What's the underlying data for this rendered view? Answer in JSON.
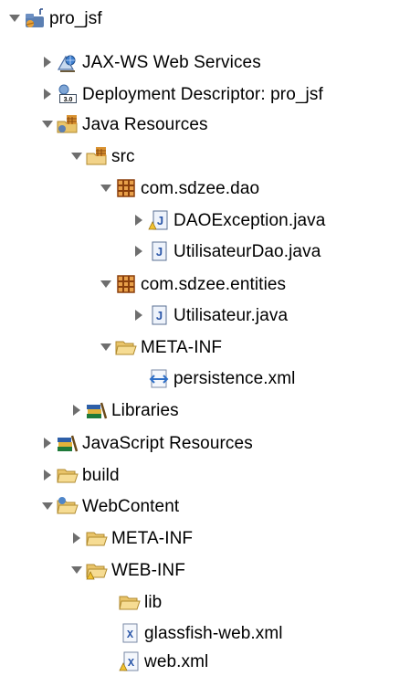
{
  "tree": {
    "nodes": [
      {
        "label": "pro_jsf",
        "icon": "project-icon",
        "expanded": true
      },
      {
        "label": "JAX-WS Web Services",
        "icon": "web-services-icon",
        "expanded": false
      },
      {
        "label": "Deployment Descriptor: pro_jsf",
        "icon": "deployment-descriptor-icon",
        "expanded": false
      },
      {
        "label": "Java Resources",
        "icon": "java-resources-icon",
        "expanded": true
      },
      {
        "label": "src",
        "icon": "source-folder-icon",
        "expanded": true
      },
      {
        "label": "com.sdzee.dao",
        "icon": "package-icon",
        "expanded": true
      },
      {
        "label": "DAOException.java",
        "icon": "java-file-warning-icon",
        "expanded": false
      },
      {
        "label": "UtilisateurDao.java",
        "icon": "java-file-icon",
        "expanded": false
      },
      {
        "label": "com.sdzee.entities",
        "icon": "package-icon",
        "expanded": true
      },
      {
        "label": "Utilisateur.java",
        "icon": "java-file-icon",
        "expanded": false
      },
      {
        "label": "META-INF",
        "icon": "folder-icon",
        "expanded": true
      },
      {
        "label": "persistence.xml",
        "icon": "persistence-xml-icon",
        "expanded": null
      },
      {
        "label": "Libraries",
        "icon": "libraries-icon",
        "expanded": false
      },
      {
        "label": "JavaScript Resources",
        "icon": "libraries-icon",
        "expanded": false
      },
      {
        "label": "build",
        "icon": "folder-icon",
        "expanded": false
      },
      {
        "label": "WebContent",
        "icon": "folder-icon",
        "expanded": true
      },
      {
        "label": "META-INF",
        "icon": "folder-icon",
        "expanded": false
      },
      {
        "label": "WEB-INF",
        "icon": "folder-icon",
        "expanded": true
      },
      {
        "label": "lib",
        "icon": "folder-icon",
        "expanded": null
      },
      {
        "label": "glassfish-web.xml",
        "icon": "xml-file-icon",
        "expanded": null
      },
      {
        "label": "web.xml",
        "icon": "xml-file-warning-icon",
        "expanded": null
      }
    ]
  }
}
